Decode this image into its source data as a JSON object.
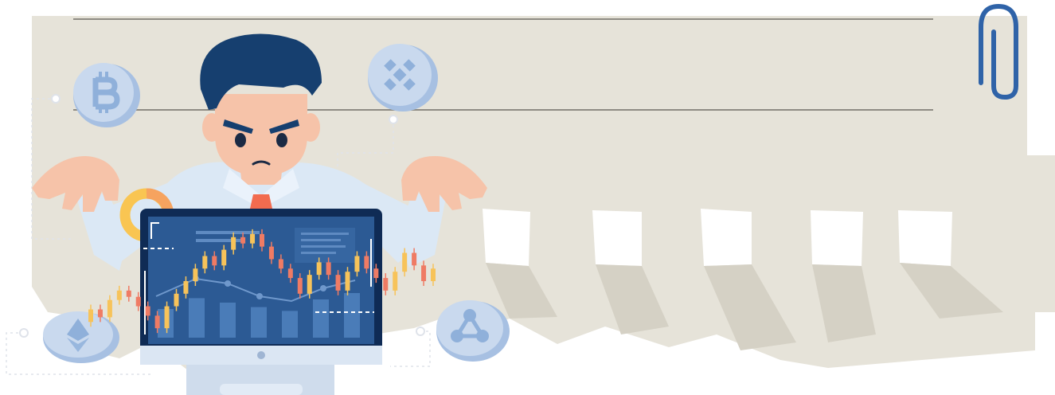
{
  "scene": {
    "description_items": [
      "torn-paper",
      "paper-clip",
      "trader-character",
      "monitor",
      "candlestick-chart",
      "crypto-coins"
    ],
    "colors": {
      "paper": "#e6e3d9",
      "paper_shadow": "#cfcbbf",
      "ruled_line": "#8e8b83",
      "paper_clip": "#2f63a8",
      "hair": "#163f6f",
      "skin": "#f6c3a9",
      "shirt": "#dbe8f5",
      "tie": "#f26b4f",
      "monitor_bezel": "#0f2b55",
      "monitor_screen": "#2c5a94",
      "candle_up": "#f7c35a",
      "candle_down": "#ef7b64",
      "donut_orange": "#f6a35f",
      "donut_yellow": "#f9c552",
      "coin": "#c9d9ee",
      "coin_rim": "#a7c0e2",
      "coin_symbol": "#8fb0da"
    },
    "coins": [
      "bitcoin",
      "binance",
      "ethereum",
      "ripple"
    ],
    "candles": [
      {
        "open": 30,
        "close": 38,
        "dir": "up"
      },
      {
        "open": 38,
        "close": 33,
        "dir": "down"
      },
      {
        "open": 33,
        "close": 44,
        "dir": "up"
      },
      {
        "open": 44,
        "close": 50,
        "dir": "up"
      },
      {
        "open": 50,
        "close": 46,
        "dir": "down"
      },
      {
        "open": 46,
        "close": 40,
        "dir": "down"
      },
      {
        "open": 40,
        "close": 34,
        "dir": "down"
      },
      {
        "open": 34,
        "close": 26,
        "dir": "down"
      },
      {
        "open": 26,
        "close": 40,
        "dir": "up"
      },
      {
        "open": 40,
        "close": 48,
        "dir": "up"
      },
      {
        "open": 48,
        "close": 56,
        "dir": "up"
      },
      {
        "open": 56,
        "close": 64,
        "dir": "up"
      },
      {
        "open": 64,
        "close": 72,
        "dir": "up"
      },
      {
        "open": 72,
        "close": 66,
        "dir": "down"
      },
      {
        "open": 66,
        "close": 76,
        "dir": "up"
      },
      {
        "open": 76,
        "close": 84,
        "dir": "up"
      },
      {
        "open": 84,
        "close": 80,
        "dir": "down"
      },
      {
        "open": 80,
        "close": 86,
        "dir": "up"
      },
      {
        "open": 86,
        "close": 78,
        "dir": "down"
      },
      {
        "open": 78,
        "close": 70,
        "dir": "down"
      },
      {
        "open": 70,
        "close": 64,
        "dir": "down"
      },
      {
        "open": 64,
        "close": 58,
        "dir": "down"
      },
      {
        "open": 58,
        "close": 48,
        "dir": "down"
      },
      {
        "open": 48,
        "close": 60,
        "dir": "up"
      },
      {
        "open": 60,
        "close": 68,
        "dir": "up"
      },
      {
        "open": 68,
        "close": 60,
        "dir": "down"
      },
      {
        "open": 60,
        "close": 50,
        "dir": "down"
      },
      {
        "open": 50,
        "close": 62,
        "dir": "up"
      },
      {
        "open": 62,
        "close": 72,
        "dir": "up"
      },
      {
        "open": 72,
        "close": 64,
        "dir": "down"
      },
      {
        "open": 64,
        "close": 58,
        "dir": "down"
      },
      {
        "open": 58,
        "close": 50,
        "dir": "down"
      },
      {
        "open": 50,
        "close": 62,
        "dir": "up"
      },
      {
        "open": 62,
        "close": 74,
        "dir": "up"
      },
      {
        "open": 74,
        "close": 66,
        "dir": "down"
      },
      {
        "open": 66,
        "close": 56,
        "dir": "down"
      },
      {
        "open": 56,
        "close": 64,
        "dir": "up"
      }
    ],
    "volume_bars": [
      0.45,
      0.62,
      0.55,
      0.48,
      0.42,
      0.6,
      0.7
    ],
    "candle_range": [
      20,
      90
    ]
  }
}
